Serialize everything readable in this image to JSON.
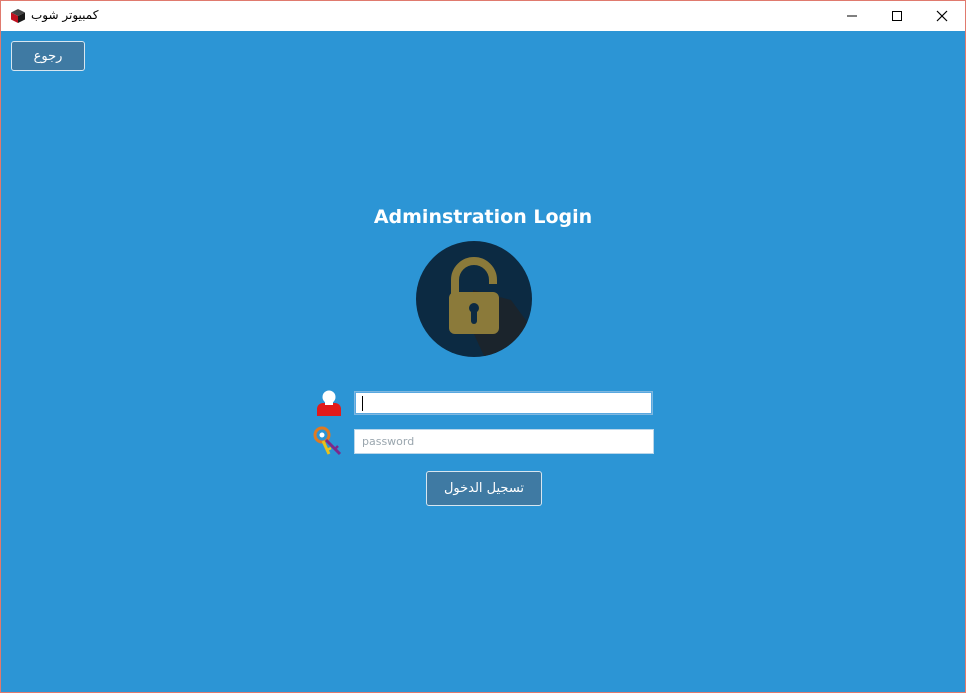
{
  "window": {
    "title": "كمبيوتر شوب",
    "icon": "app-box-icon",
    "controls": [
      "minimize-icon",
      "maximize-icon",
      "close-icon"
    ]
  },
  "toolbar": {
    "back_label": "رجوع"
  },
  "login": {
    "title": "Adminstration Login",
    "lock_icon": "unlocked-padlock-icon",
    "username": {
      "value": "",
      "placeholder": "",
      "icon": "user-icon"
    },
    "password": {
      "value": "",
      "placeholder": "password",
      "icon": "keys-icon"
    },
    "submit_label": "تسجيل الدخول"
  },
  "colors": {
    "background": "#2c95d5",
    "button": "#3f7aa3",
    "lock_circle": "#0c2a42",
    "lock_body": "#8b7a3a"
  }
}
